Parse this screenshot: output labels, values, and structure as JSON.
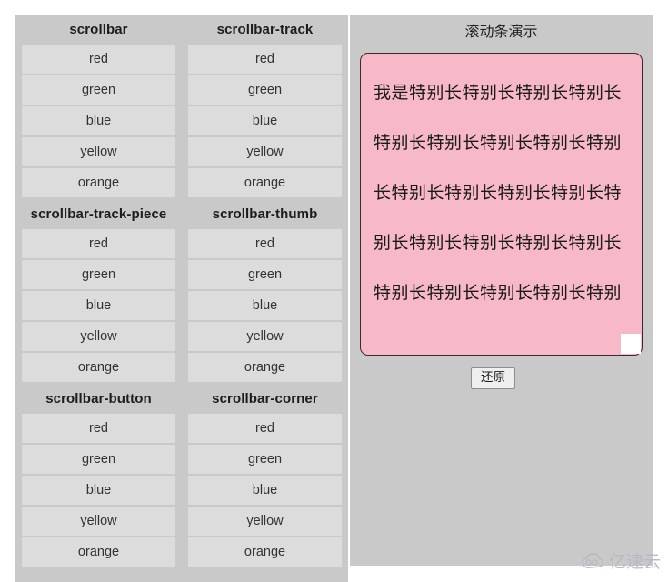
{
  "page": {
    "background": "#ffffff",
    "panel_background": "#c9c9c9",
    "cell_background": "#dcdcdc",
    "textarea_background": "#f7b8c7"
  },
  "left_panel": {
    "groups": [
      {
        "heading": "scrollbar",
        "options": [
          "red",
          "green",
          "blue",
          "yellow",
          "orange"
        ]
      },
      {
        "heading": "scrollbar-track",
        "options": [
          "red",
          "green",
          "blue",
          "yellow",
          "orange"
        ]
      },
      {
        "heading": "scrollbar-track-piece",
        "options": [
          "red",
          "green",
          "blue",
          "yellow",
          "orange"
        ]
      },
      {
        "heading": "scrollbar-thumb",
        "options": [
          "red",
          "green",
          "blue",
          "yellow",
          "orange"
        ]
      },
      {
        "heading": "scrollbar-button",
        "options": [
          "red",
          "green",
          "blue",
          "yellow",
          "orange"
        ]
      },
      {
        "heading": "scrollbar-corner",
        "options": [
          "red",
          "green",
          "blue",
          "yellow",
          "orange"
        ]
      }
    ]
  },
  "right_panel": {
    "title": "滚动条演示",
    "textarea_value": "我是特别长特别长特别长特别长特别长特别长特别长特别长特别长特别长特别长特别长特别长特别长特别长特别长特别长特别长特别长特别长特别长特别长特别",
    "restore_button": "还原"
  },
  "watermark": {
    "text": "亿速云",
    "icon": "cloud-icon"
  }
}
